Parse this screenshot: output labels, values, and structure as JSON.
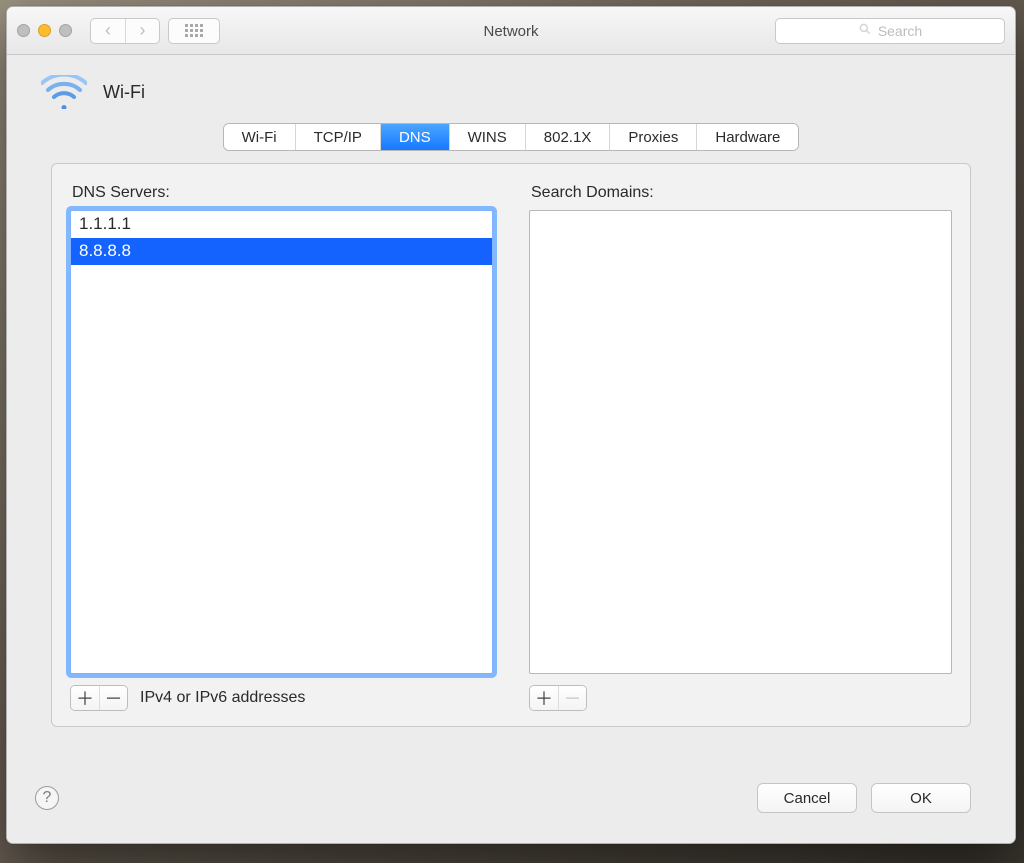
{
  "window": {
    "title": "Network",
    "search_placeholder": "Search"
  },
  "header": {
    "interface_label": "Wi-Fi"
  },
  "tabs": [
    {
      "label": "Wi-Fi",
      "active": false
    },
    {
      "label": "TCP/IP",
      "active": false
    },
    {
      "label": "DNS",
      "active": true
    },
    {
      "label": "WINS",
      "active": false
    },
    {
      "label": "802.1X",
      "active": false
    },
    {
      "label": "Proxies",
      "active": false
    },
    {
      "label": "Hardware",
      "active": false
    }
  ],
  "dns": {
    "servers_label": "DNS Servers:",
    "servers": [
      {
        "value": "1.1.1.1",
        "selected": false
      },
      {
        "value": "8.8.8.8",
        "selected": true
      }
    ],
    "hint": "IPv4 or IPv6 addresses"
  },
  "search_domains": {
    "label": "Search Domains:",
    "items": []
  },
  "buttons": {
    "cancel": "Cancel",
    "ok": "OK"
  },
  "glyphs": {
    "plus": "＋",
    "minus": "－",
    "chevron_left": "‹",
    "chevron_right": "›",
    "help": "?",
    "search": "🔍"
  }
}
